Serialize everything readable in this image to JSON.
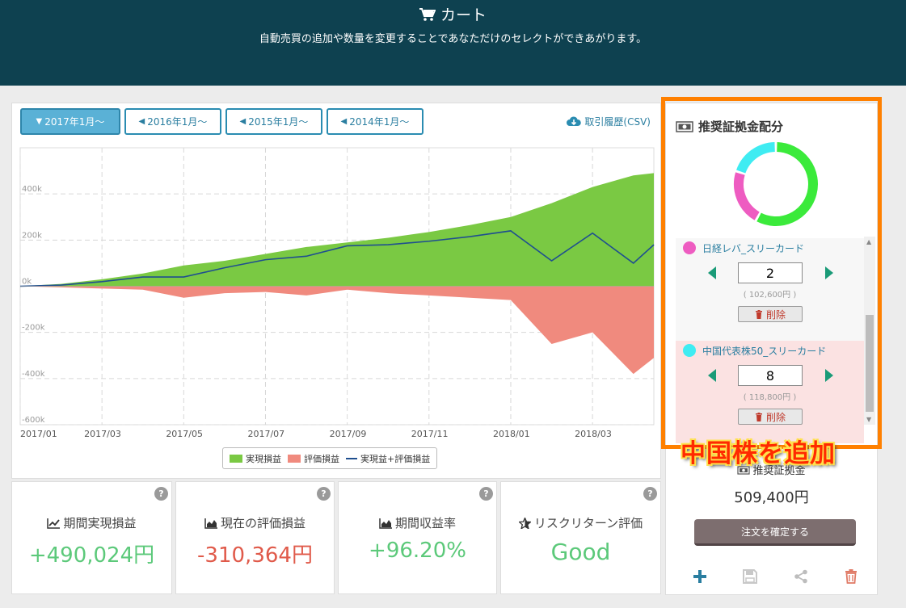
{
  "header": {
    "title": "カート",
    "subtitle": "自動売買の追加や数量を変更することであなただけのセレクトができあがります。"
  },
  "period_tabs": [
    {
      "label": "2017年1月～",
      "active": true
    },
    {
      "label": "2016年1月～",
      "active": false
    },
    {
      "label": "2015年1月～",
      "active": false
    },
    {
      "label": "2014年1月～",
      "active": false
    }
  ],
  "csv_link": "取引履歴(CSV)",
  "chart_data": {
    "type": "area",
    "x_ticks": [
      "2017/01",
      "2017/03",
      "2017/05",
      "2017/07",
      "2017/09",
      "2017/11",
      "2018/01",
      "2018/03"
    ],
    "y_ticks": [
      "400k",
      "200k",
      "0k",
      "-200k",
      "-400k",
      "-600k"
    ],
    "ylim": [
      -600000,
      600000
    ],
    "grid": true,
    "legend_placement": "bottom",
    "legend": [
      "実現損益",
      "評価損益",
      "実現益+評価損益"
    ],
    "series": [
      {
        "name": "実現損益",
        "color": "#7ac943",
        "x": [
          0,
          1,
          2,
          3,
          4,
          5,
          6,
          7,
          8,
          9,
          10,
          11,
          12,
          13,
          14,
          15,
          15.5
        ],
        "values": [
          0,
          10000,
          30000,
          55000,
          90000,
          110000,
          140000,
          170000,
          190000,
          210000,
          235000,
          265000,
          300000,
          360000,
          430000,
          480000,
          490024
        ]
      },
      {
        "name": "評価損益",
        "color": "#f08a7e",
        "x": [
          0,
          1,
          2,
          3,
          4,
          5,
          6,
          7,
          8,
          9,
          10,
          11,
          12,
          13,
          14,
          15,
          15.5
        ],
        "values": [
          0,
          -5000,
          -10000,
          -15000,
          -50000,
          -30000,
          -25000,
          -40000,
          -15000,
          -30000,
          -40000,
          -50000,
          -60000,
          -250000,
          -200000,
          -380000,
          -310364
        ]
      },
      {
        "name": "実現益+評価損益",
        "color": "#1f4f8f",
        "x": [
          0,
          1,
          2,
          3,
          4,
          5,
          6,
          7,
          8,
          9,
          10,
          11,
          12,
          13,
          14,
          15,
          15.5
        ],
        "values": [
          0,
          5000,
          20000,
          40000,
          40000,
          80000,
          115000,
          130000,
          175000,
          180000,
          195000,
          215000,
          240000,
          110000,
          230000,
          100000,
          179660
        ]
      }
    ]
  },
  "stats": [
    {
      "label": "期間実現損益",
      "value": "+490,024円",
      "color": "#5cc97a",
      "icon": "line-chart-icon"
    },
    {
      "label": "現在の評価損益",
      "value": "-310,364円",
      "color": "#e05a4a",
      "icon": "area-chart-icon"
    },
    {
      "label": "期間収益率",
      "value": "+96.20%",
      "color": "#5cc97a",
      "icon": "area-chart-icon"
    },
    {
      "label": "リスクリターン評価",
      "value": "Good",
      "color": "#5cc97a",
      "icon": "star-icon"
    }
  ],
  "sidebar": {
    "title": "推奨証拠金配分",
    "donut": [
      {
        "color": "#3bea3b",
        "fraction": 0.58
      },
      {
        "color": "#ee5cc1",
        "fraction": 0.22
      },
      {
        "color": "#3fecf2",
        "fraction": 0.2
      }
    ],
    "items": [
      {
        "name": "日経レバ_スリーカード",
        "color": "#ee5cc1",
        "qty": "2",
        "price": "( 102,600円 )",
        "delete_label": "削除",
        "bg": "#f7f7f7"
      },
      {
        "name": "中国代表株50_スリーカード",
        "color": "#3fecf2",
        "qty": "8",
        "price": "( 118,800円 )",
        "delete_label": "削除",
        "bg": "#fbe2e2"
      }
    ],
    "callout": "中国株を追加",
    "margin_label": "推奨証拠金",
    "margin_value": "509,400円",
    "confirm_label": "注文を確定する"
  }
}
